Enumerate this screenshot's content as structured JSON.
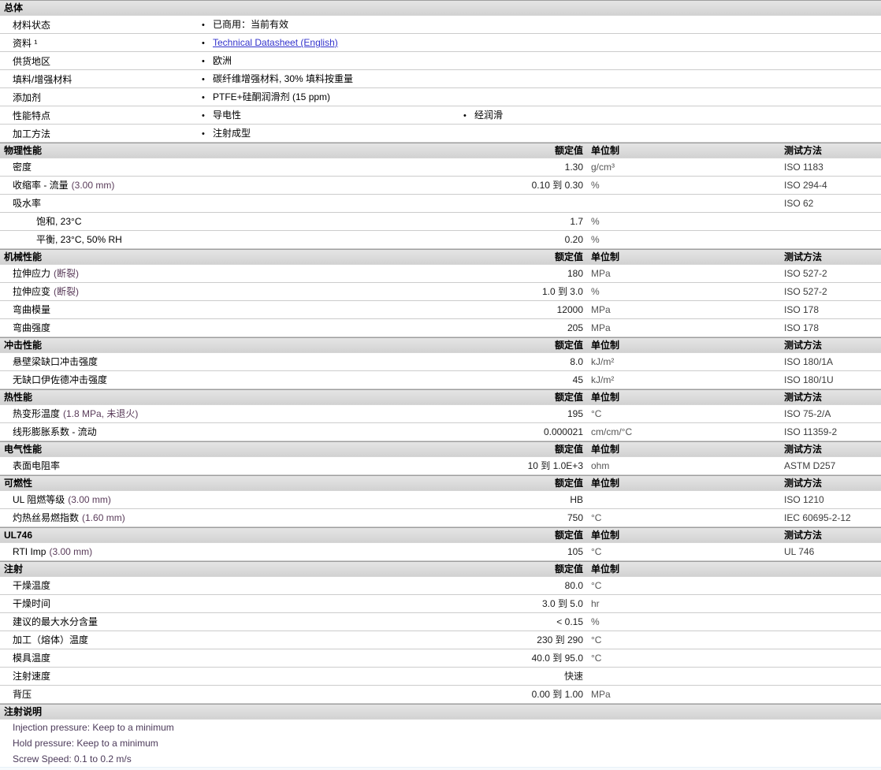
{
  "icons": {
    "bullet": "•"
  },
  "colors": {
    "link": "#3333cc",
    "condition_text": "#5a3c5a",
    "note_text": "#4c3a5a",
    "section_header_bg": "#d8d8d8",
    "footer_bar": "#4c7cab"
  },
  "columns": {
    "value": "额定值",
    "unit": "单位制",
    "method": "测试方法"
  },
  "general": {
    "title": "总体",
    "rows": [
      {
        "label": "材料状态",
        "bullet1": "已商用：当前有效"
      },
      {
        "label": "资料 ¹",
        "link": "Technical Datasheet (English)"
      },
      {
        "label": "供货地区",
        "bullet1": "欧洲"
      },
      {
        "label": "填料/增强材料",
        "bullet1": "碳纤维增强材料, 30% 填料按重量"
      },
      {
        "label": "添加剂",
        "bullet1": "PTFE+硅酮润滑剂 (15 ppm)"
      },
      {
        "label": "性能特点",
        "bullet1": "导电性",
        "bullet2": "经润滑"
      },
      {
        "label": "加工方法",
        "bullet1": "注射成型"
      }
    ]
  },
  "physical": {
    "title": "物理性能",
    "rows": [
      {
        "label": "密度",
        "value": "1.30",
        "unit": "g/cm³",
        "method": "ISO 1183"
      },
      {
        "label": "收缩率 - 流量",
        "cond": "(3.00 mm)",
        "value": "0.10 到 0.30",
        "unit": "%",
        "method": "ISO 294-4"
      },
      {
        "label": "吸水率",
        "method": "ISO 62"
      },
      {
        "label": "饱和, 23°C",
        "value": "1.7",
        "unit": "%"
      },
      {
        "label": "平衡, 23°C, 50% RH",
        "value": "0.20",
        "unit": "%"
      }
    ]
  },
  "mechanical": {
    "title": "机械性能",
    "rows": [
      {
        "label": "拉伸应力",
        "cond": "(断裂)",
        "value": "180",
        "unit": "MPa",
        "method": "ISO 527-2"
      },
      {
        "label": "拉伸应变",
        "cond": "(断裂)",
        "value": "1.0 到 3.0",
        "unit": "%",
        "method": "ISO 527-2"
      },
      {
        "label": "弯曲模量",
        "value": "12000",
        "unit": "MPa",
        "method": "ISO 178"
      },
      {
        "label": "弯曲强度",
        "value": "205",
        "unit": "MPa",
        "method": "ISO 178"
      }
    ]
  },
  "impact": {
    "title": "冲击性能",
    "rows": [
      {
        "label": "悬壁梁缺口冲击强度",
        "value": "8.0",
        "unit": "kJ/m²",
        "method": "ISO 180/1A"
      },
      {
        "label": "无缺口伊佐德冲击强度",
        "value": "45",
        "unit": "kJ/m²",
        "method": "ISO 180/1U"
      }
    ]
  },
  "thermal": {
    "title": "热性能",
    "rows": [
      {
        "label": "热变形温度",
        "cond": "(1.8 MPa, 未退火)",
        "value": "195",
        "unit": "°C",
        "method": "ISO 75-2/A"
      },
      {
        "label": "线形膨胀系数 - 流动",
        "value": "0.000021",
        "unit": "cm/cm/°C",
        "method": "ISO 11359-2"
      }
    ]
  },
  "electrical": {
    "title": "电气性能",
    "rows": [
      {
        "label": "表面电阻率",
        "value": "10 到 1.0E+3",
        "unit": "ohm",
        "method": "ASTM D257"
      }
    ]
  },
  "flammability": {
    "title": "可燃性",
    "rows": [
      {
        "label": "UL 阻燃等级",
        "cond": "(3.00 mm)",
        "value": "HB",
        "method": "ISO 1210"
      },
      {
        "label": "灼热丝易燃指数",
        "cond": "(1.60 mm)",
        "value": "750",
        "unit": "°C",
        "method": "IEC 60695-2-12"
      }
    ]
  },
  "ul746": {
    "title": "UL746",
    "rows": [
      {
        "label": "RTI Imp",
        "cond": "(3.00 mm)",
        "value": "105",
        "unit": "°C",
        "method": "UL 746"
      }
    ]
  },
  "injection": {
    "title": "注射",
    "rows": [
      {
        "label": "干燥温度",
        "value": "80.0",
        "unit": "°C"
      },
      {
        "label": "干燥时间",
        "value": "3.0 到 5.0",
        "unit": "hr"
      },
      {
        "label": "建议的最大水分含量",
        "value": "< 0.15",
        "unit": "%"
      },
      {
        "label": "加工（熔体）温度",
        "value": "230 到 290",
        "unit": "°C"
      },
      {
        "label": "模具温度",
        "value": "40.0 到 95.0",
        "unit": "°C"
      },
      {
        "label": "注射速度",
        "value": "快速"
      },
      {
        "label": "背压",
        "value": "0.00 到 1.00",
        "unit": "MPa"
      }
    ]
  },
  "notes": {
    "title": "注射说明",
    "lines": [
      "Injection pressure: Keep to a minimum",
      "Hold pressure: Keep to a minimum",
      "Screw Speed: 0.1 to 0.2 m/s"
    ]
  }
}
